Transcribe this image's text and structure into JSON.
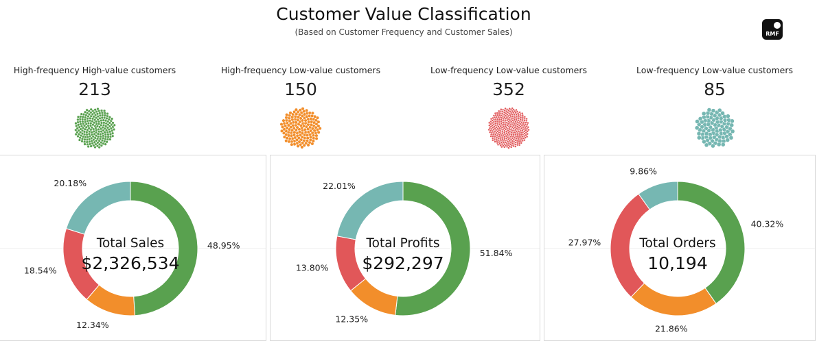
{
  "header": {
    "title": "Customer Value Classification",
    "subtitle": "(Based on Customer Frequency and Customer Sales)",
    "logo_text": "RMF"
  },
  "colors": {
    "high_high": "#59a14f",
    "high_low": "#f28e2b",
    "low_low_red": "#e15759",
    "low_low_teal": "#76b7b2"
  },
  "segments": [
    {
      "label": "High-frequency High-value customers",
      "count": "213",
      "color": "#59a14f"
    },
    {
      "label": "High-frequency Low-value customers",
      "count": "150",
      "color": "#f28e2b"
    },
    {
      "label": "Low-frequency Low-value customers",
      "count": "352",
      "color": "#e15759"
    },
    {
      "label": "Low-frequency Low-value customers",
      "count": "85",
      "color": "#76b7b2"
    }
  ],
  "chart_data": [
    {
      "type": "pie",
      "donut": true,
      "center_title": "Total Sales",
      "center_value": "$2,326,534",
      "slices": [
        {
          "value": 48.95,
          "label": "48.95%",
          "color": "#59a14f"
        },
        {
          "value": 12.34,
          "label": "12.34%",
          "color": "#f28e2b"
        },
        {
          "value": 18.54,
          "label": "18.54%",
          "color": "#e15759"
        },
        {
          "value": 20.18,
          "label": "20.18%",
          "color": "#76b7b2"
        }
      ]
    },
    {
      "type": "pie",
      "donut": true,
      "center_title": "Total Profits",
      "center_value": "$292,297",
      "slices": [
        {
          "value": 51.84,
          "label": "51.84%",
          "color": "#59a14f"
        },
        {
          "value": 12.35,
          "label": "12.35%",
          "color": "#f28e2b"
        },
        {
          "value": 13.8,
          "label": "13.80%",
          "color": "#e15759"
        },
        {
          "value": 22.01,
          "label": "22.01%",
          "color": "#76b7b2"
        }
      ]
    },
    {
      "type": "pie",
      "donut": true,
      "center_title": "Total Orders",
      "center_value": "10,194",
      "slices": [
        {
          "value": 40.32,
          "label": "40.32%",
          "color": "#59a14f"
        },
        {
          "value": 21.86,
          "label": "21.86%",
          "color": "#f28e2b"
        },
        {
          "value": 27.97,
          "label": "27.97%",
          "color": "#e15759"
        },
        {
          "value": 9.86,
          "label": "9.86%",
          "color": "#76b7b2"
        }
      ]
    }
  ]
}
